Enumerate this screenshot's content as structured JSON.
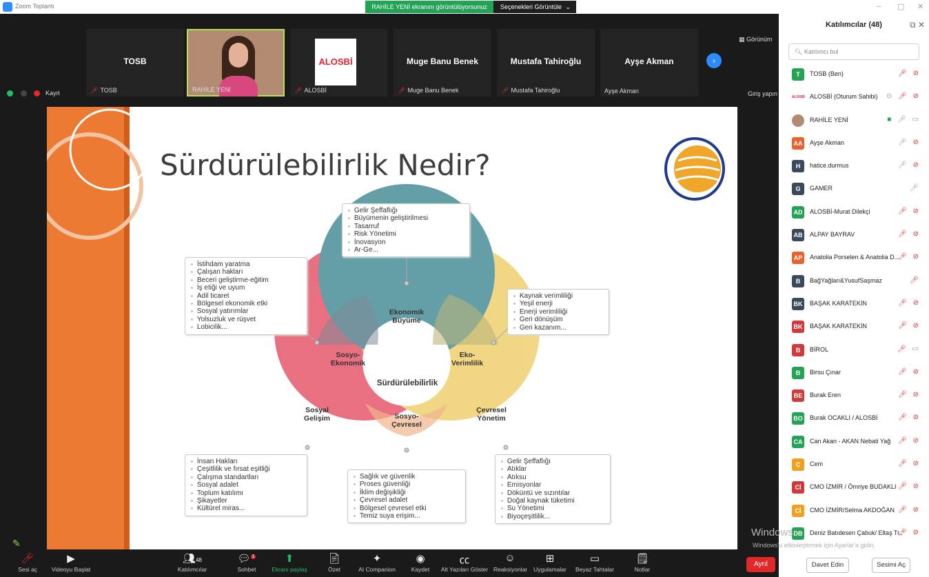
{
  "window": {
    "title": "Zoom Toplantı"
  },
  "banner": {
    "viewing": "RAHİLE YENİ ekranını görüntülüyorsunuz",
    "view_options": "Seçenekleri Görüntüle"
  },
  "gallery": {
    "view_label": "Görünüm"
  },
  "thumbnails": [
    {
      "name": "TOSB",
      "label": "TOSB"
    },
    {
      "name": "",
      "label": "RAHİLE YENİ"
    },
    {
      "name": "ALOSBİ",
      "label": "ALOSBİ"
    },
    {
      "name": "Muge Banu Benek",
      "label": "Muge Banu Benek"
    },
    {
      "name": "Mustafa Tahiroğlu",
      "label": "Mustafa Tahiroğlu"
    },
    {
      "name": "Ayşe Akman",
      "label": "Ayşe Akman"
    }
  ],
  "record": {
    "label": "Kayıt"
  },
  "signin": {
    "label": "Giriş yapın"
  },
  "slide": {
    "title": "Sürdürülebilirlik Nedir?",
    "circles": {
      "ekonomik": "Ekonomik\nBüyüme",
      "sosyal": "Sosyal\nGelişim",
      "cevresel": "Çevresel\nYönetim",
      "sosyo_ekonomik": "Sosyo-\nEkonomik",
      "eko_verimlilik": "Eko-\nVerimlilik",
      "sosyo_cevresel": "Sosyo-\nÇevresel",
      "center": "Sürdürülebilirlik"
    },
    "boxes": {
      "top": [
        "Gelir Şeffaflığı",
        "Büyümenin geliştirilmesi",
        "Tasarruf",
        "Risk Yönetimi",
        "İnovasyon",
        "Ar-Ge..."
      ],
      "left_top": [
        "İstihdam yaratma",
        "Çalışan hakları",
        "Beceri geliştirme-eğitim",
        "İş etiği ve uyum",
        "Adil ticaret",
        "Bölgesel ekonomik etki",
        "Sosyal yatırımlar",
        "Yolsuzluk ve rüşvet",
        "Lobicilik..."
      ],
      "right_top": [
        "Kaynak verimliliği",
        "Yeşil enerji",
        "Enerji verimliliği",
        "Geri dönüşüm",
        "Geri kazanım..."
      ],
      "left_bottom": [
        "İnsan Hakları",
        "Çeşitlilik ve fırsat eşitliği",
        "Çalışma standartları",
        "Sosyal adalet",
        "Toplum katılımı",
        "Şikayetler",
        "Kültürel miras..."
      ],
      "center_bottom": [
        "Sağlık ve güvenlik",
        "Proses güvenliği",
        "İklim değişikliği",
        "Çevresel adalet",
        "Bölgesel çevresel etki",
        "Temiz suya erişim..."
      ],
      "right_bottom": [
        "Gelir Şeffaflığı",
        "Atıklar",
        "Atıksu",
        "Emisyonlar",
        "Döküntü ve sızıntılar",
        "Doğal kaynak tüketimi",
        "Su Yönetimi",
        "Biyoçeşitlilik..."
      ]
    }
  },
  "toolbar": {
    "audio": "Sesi aç",
    "video": "Videoyu Başlat",
    "participants": "Katılımcılar",
    "participants_count": "48",
    "chat": "Sohbet",
    "chat_badge": "1",
    "share": "Ekranı paylaş",
    "summary": "Özet",
    "companion": "AI Companion",
    "record": "Kaydet",
    "captions": "Alt Yazıları Göster",
    "reactions": "Reaksiyonlar",
    "apps": "Uygulamalar",
    "whiteboards": "Beyaz Tahtalar",
    "notes": "Notlar",
    "leave": "Ayrıl"
  },
  "panel": {
    "title": "Katılımcılar (48)",
    "search_placeholder": "Katılımcı bul",
    "participants": [
      {
        "initials": "T",
        "name": "TOSB (Ben)",
        "color": "#23a455"
      },
      {
        "initials": "ALOSBİ",
        "name": "ALOSBİ (Oturum Sahibi)",
        "color": "#ffffff"
      },
      {
        "initials": "",
        "name": "RAHİLE YENİ",
        "color": "#b38a72"
      },
      {
        "initials": "AA",
        "name": "Ayşe Akman",
        "color": "#e8622c"
      },
      {
        "initials": "H",
        "name": "hatice.durmus",
        "color": "#3a4a5c"
      },
      {
        "initials": "G",
        "name": "GAMER",
        "color": "#3a4a5c"
      },
      {
        "initials": "AD",
        "name": "ALOSBİ-Murat Dilekçi",
        "color": "#23a455"
      },
      {
        "initials": "AB",
        "name": "ALPAY BAYRAV",
        "color": "#3a4a5c"
      },
      {
        "initials": "AP",
        "name": "Anatolia Porselen & Anatolia D...",
        "color": "#e8622c"
      },
      {
        "initials": "B",
        "name": "BağYağları&YusufSaşmaz",
        "color": "#3a4a5c"
      },
      {
        "initials": "BK",
        "name": "BAŞAK KARATEKİN",
        "color": "#3a4a5c"
      },
      {
        "initials": "BK",
        "name": "BAŞAK KARATEKİN",
        "color": "#d23a3a"
      },
      {
        "initials": "B",
        "name": "BİROL",
        "color": "#d23a3a"
      },
      {
        "initials": "B",
        "name": "Birsu Çınar",
        "color": "#23a455"
      },
      {
        "initials": "BE",
        "name": "Burak Eren",
        "color": "#d23a3a"
      },
      {
        "initials": "BO",
        "name": "Burak OCAKLI / ALOSBİ",
        "color": "#23a455"
      },
      {
        "initials": "CA",
        "name": "Can Akan - AKAN Nebati Yağ",
        "color": "#23a455"
      },
      {
        "initials": "C",
        "name": "Cem",
        "color": "#f0a01e"
      },
      {
        "initials": "Cİ",
        "name": "CMO İZMİR / Ömriye BUDAKLI",
        "color": "#d23a3a"
      },
      {
        "initials": "Cİ",
        "name": "CMO İZMİR/Selma AKDOĞAN",
        "color": "#f0a01e"
      },
      {
        "initials": "DB",
        "name": "Deniz Batıdesen Çabuk/ Eltaş Tr...",
        "color": "#23a455"
      }
    ],
    "invite": "Davet Edin",
    "unmute_all": "Sesimi Aç"
  },
  "watermark": {
    "line1": "Windows",
    "line2": "Windows'u etkinleştirmek için Ayarlar'a gidin."
  }
}
